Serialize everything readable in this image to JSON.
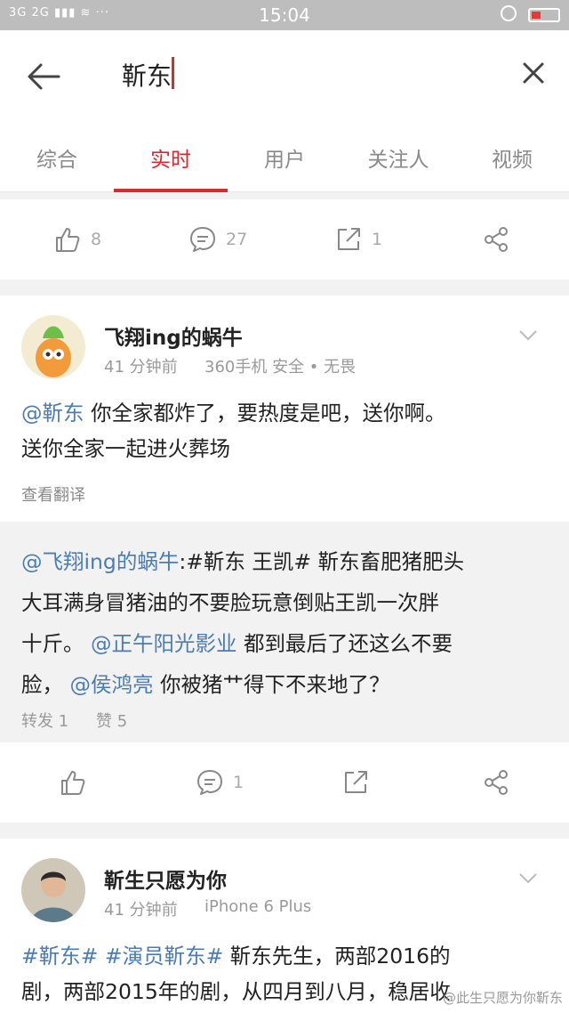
{
  "status": {
    "signal": "3G 2G ▮▮▮ ≋ ···",
    "time": "15:04"
  },
  "search": {
    "query": "靳东"
  },
  "tabs": [
    "综合",
    "实时",
    "用户",
    "关注人",
    "视频"
  ],
  "top_actions": {
    "like": "8",
    "comment": "27",
    "repost": "1"
  },
  "post1": {
    "username": "飞翔ing的蜗牛",
    "time": "41 分钟前",
    "source": "360手机 安全 • 无畏",
    "mention": "@靳东",
    "text_line1": "你全家都炸了，要热度是吧，送你啊。",
    "text_line2": "送你全家一起进火葬场",
    "translate": "查看翻译",
    "repost_mention": "@飞翔ing的蜗牛",
    "repost_l1": ":#靳东 王凯# 靳东畜肥猪肥头",
    "repost_l2": "大耳满身冒猪油的不要脸玩意倒贴王凯一次胖",
    "repost_l3a": "十斤。",
    "repost_link1": "@正午阳光影业",
    "repost_l3b": "都到最后了还这么不要",
    "repost_l4a": "脸，",
    "repost_link2": "@侯鸿亮",
    "repost_l4b": "你被猪艹得下不来地了？",
    "repost_count": "转发 1",
    "like_count": "赞 5",
    "actions": {
      "comment": "1"
    }
  },
  "post2": {
    "username": "靳生只愿为你",
    "time": "41 分钟前",
    "source": "iPhone 6 Plus",
    "tag1": "#靳东#",
    "tag2": "#演员靳东#",
    "text_line1": "靳东先生，两部2016的",
    "text_line2": "剧，两部2015年的剧，从四月到八月，稳居收"
  },
  "watermark": "@此生只愿为你靳东"
}
